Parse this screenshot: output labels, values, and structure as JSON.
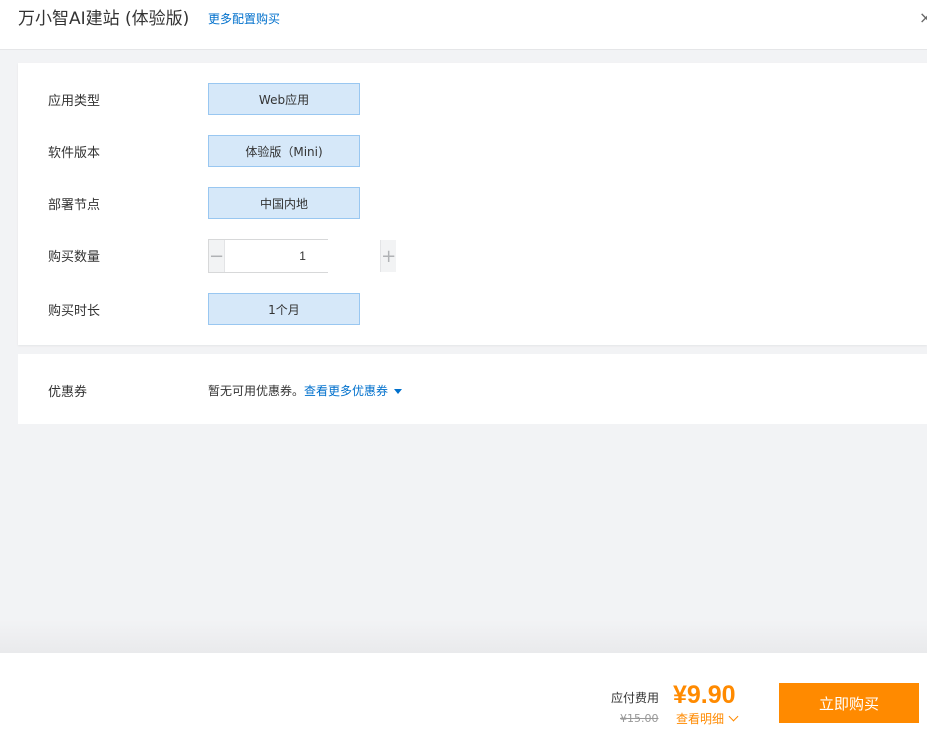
{
  "header": {
    "title": "万小智AI建站 (体验版)",
    "more_link": "更多配置购买",
    "close_glyph": "×"
  },
  "config": {
    "app_type": {
      "label": "应用类型",
      "value": "Web应用"
    },
    "software_version": {
      "label": "软件版本",
      "value": "体验版（Mini)"
    },
    "deploy_node": {
      "label": "部署节点",
      "value": "中国内地"
    },
    "quantity": {
      "label": "购买数量",
      "value": "1",
      "minus": "−",
      "plus": "+"
    },
    "duration": {
      "label": "购买时长",
      "value": "1个月"
    }
  },
  "coupon": {
    "label": "优惠券",
    "text": "暂无可用优惠券。",
    "link": "查看更多优惠券"
  },
  "footer": {
    "due_label": "应付费用",
    "original_price": "¥15.00",
    "price": "¥9.90",
    "detail_link": "查看明细",
    "buy_button": "立即购买"
  },
  "colors": {
    "accent_orange": "#ff8a00",
    "link_blue": "#0070cc",
    "option_bg": "#d6e8f9",
    "option_border": "#99c7f1"
  }
}
